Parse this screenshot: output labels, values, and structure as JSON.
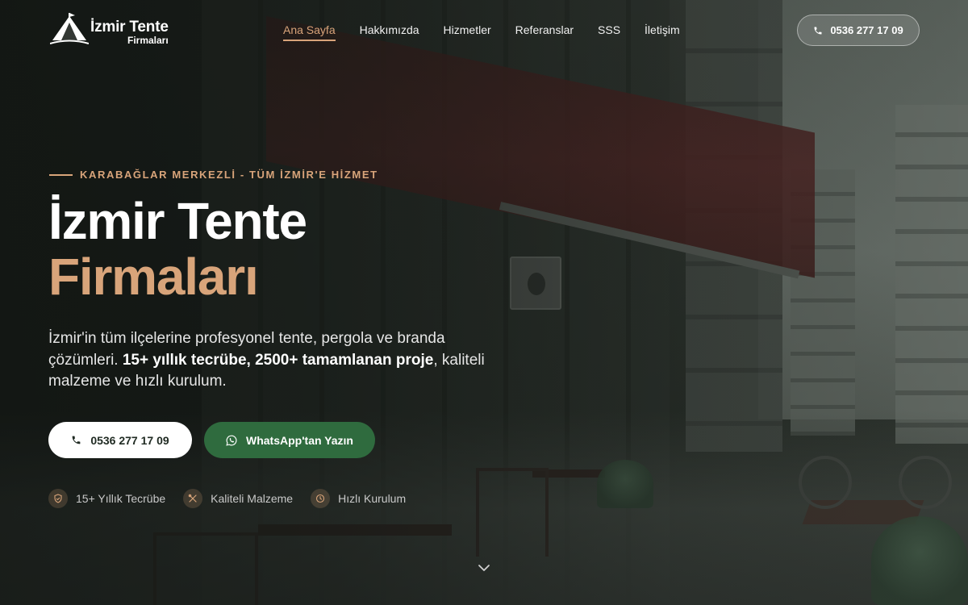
{
  "brand": {
    "title": "İzmir Tente",
    "subtitle": "Firmaları"
  },
  "nav": {
    "items": [
      {
        "label": "Ana Sayfa",
        "active": true
      },
      {
        "label": "Hakkımızda",
        "active": false
      },
      {
        "label": "Hizmetler",
        "active": false
      },
      {
        "label": "Referanslar",
        "active": false
      },
      {
        "label": "SSS",
        "active": false
      },
      {
        "label": "İletişim",
        "active": false
      }
    ]
  },
  "header": {
    "phone": "0536 277 17 09",
    "phone_icon": "phone-icon"
  },
  "hero": {
    "eyebrow": "KARABAĞLAR MERKEZLİ - TÜM İZMİR'E HİZMET",
    "title_line1": "İzmir Tente",
    "title_line2": "Firmaları",
    "lead_part1": "İzmir'in tüm ilçelerine profesyonel tente, pergola ve branda çözümleri. ",
    "lead_bold": "15+ yıllık tecrübe, 2500+ tamamlanan proje",
    "lead_part2": ", kaliteli malzeme ve hızlı kurulum.",
    "call_label": "0536 277 17 09",
    "whatsapp_label": "WhatsApp'tan Yazın"
  },
  "features": [
    {
      "label": "15+ Yıllık Tecrübe",
      "icon": "shield-check-icon"
    },
    {
      "label": "Kaliteli Malzeme",
      "icon": "tools-icon"
    },
    {
      "label": "Hızlı Kurulum",
      "icon": "clock-icon"
    }
  ],
  "colors": {
    "accent": "#d8a47a",
    "whatsapp_green": "#2f6b3e",
    "background": "#1d221e"
  }
}
